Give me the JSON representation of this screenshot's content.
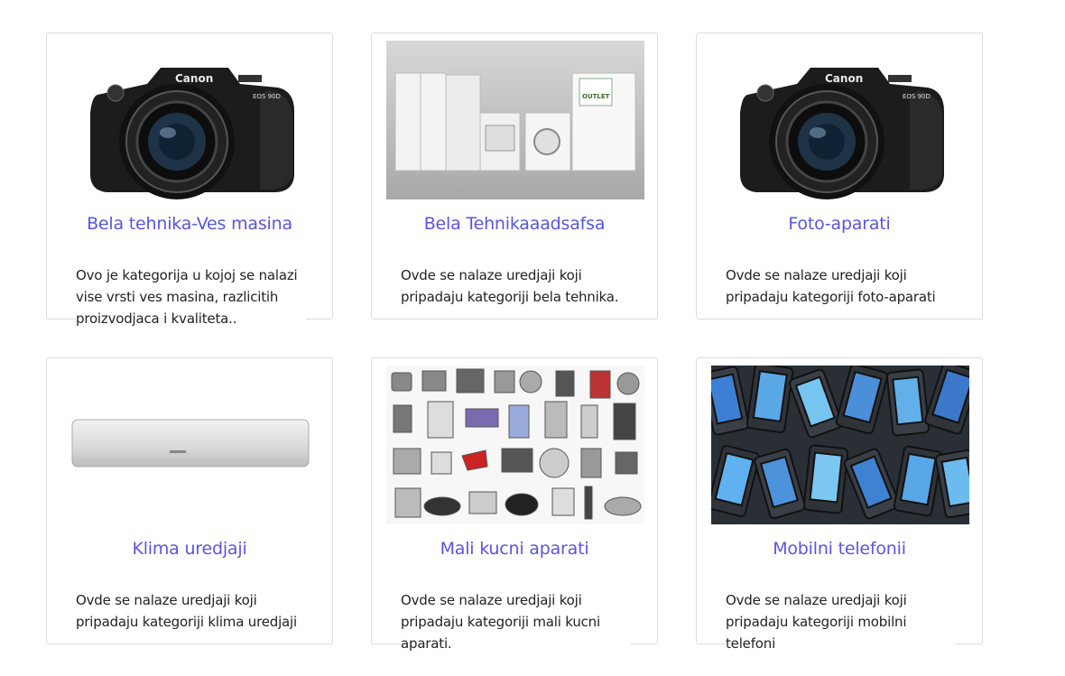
{
  "categories": [
    {
      "title": "Bela tehnika-Ves masina",
      "description": "Ovo je kategorija u kojoj se nalazi vise vrsti ves masina, razlicitih proizvodjaca i kvaliteta..",
      "image": "camera-image"
    },
    {
      "title": "Bela Tehnikaaadsafsa",
      "description": "Ovde se nalaze uredjaji koji pripadaju kategoriji bela tehnika.",
      "image": "appliances-image"
    },
    {
      "title": "Foto-aparati",
      "description": "Ovde se nalaze uredjaji koji pripadaju kategoriji foto-aparati",
      "image": "camera-image"
    },
    {
      "title": "Klima uredjaji",
      "description": "Ovde se nalaze uredjaji koji pripadaju kategoriji klima uredjaji",
      "image": "air-conditioner-image"
    },
    {
      "title": "Mali kucni aparati",
      "description": "Ovde se nalaze uredjaji koji pripadaju kategoriji mali kucni aparati.",
      "image": "small-appliances-image"
    },
    {
      "title": "Mobilni telefonii",
      "description": "Ovde se nalaze uredjaji koji pripadaju kategoriji mobilni telefoni",
      "image": "mobile-phones-image"
    }
  ],
  "image_text": {
    "camera_brand": "Canon",
    "camera_model": "EOS 90D",
    "outlet_logo": "OUTLET"
  },
  "colors": {
    "title": "#5a55e0",
    "border": "#dcdcdc",
    "text": "#222222"
  }
}
